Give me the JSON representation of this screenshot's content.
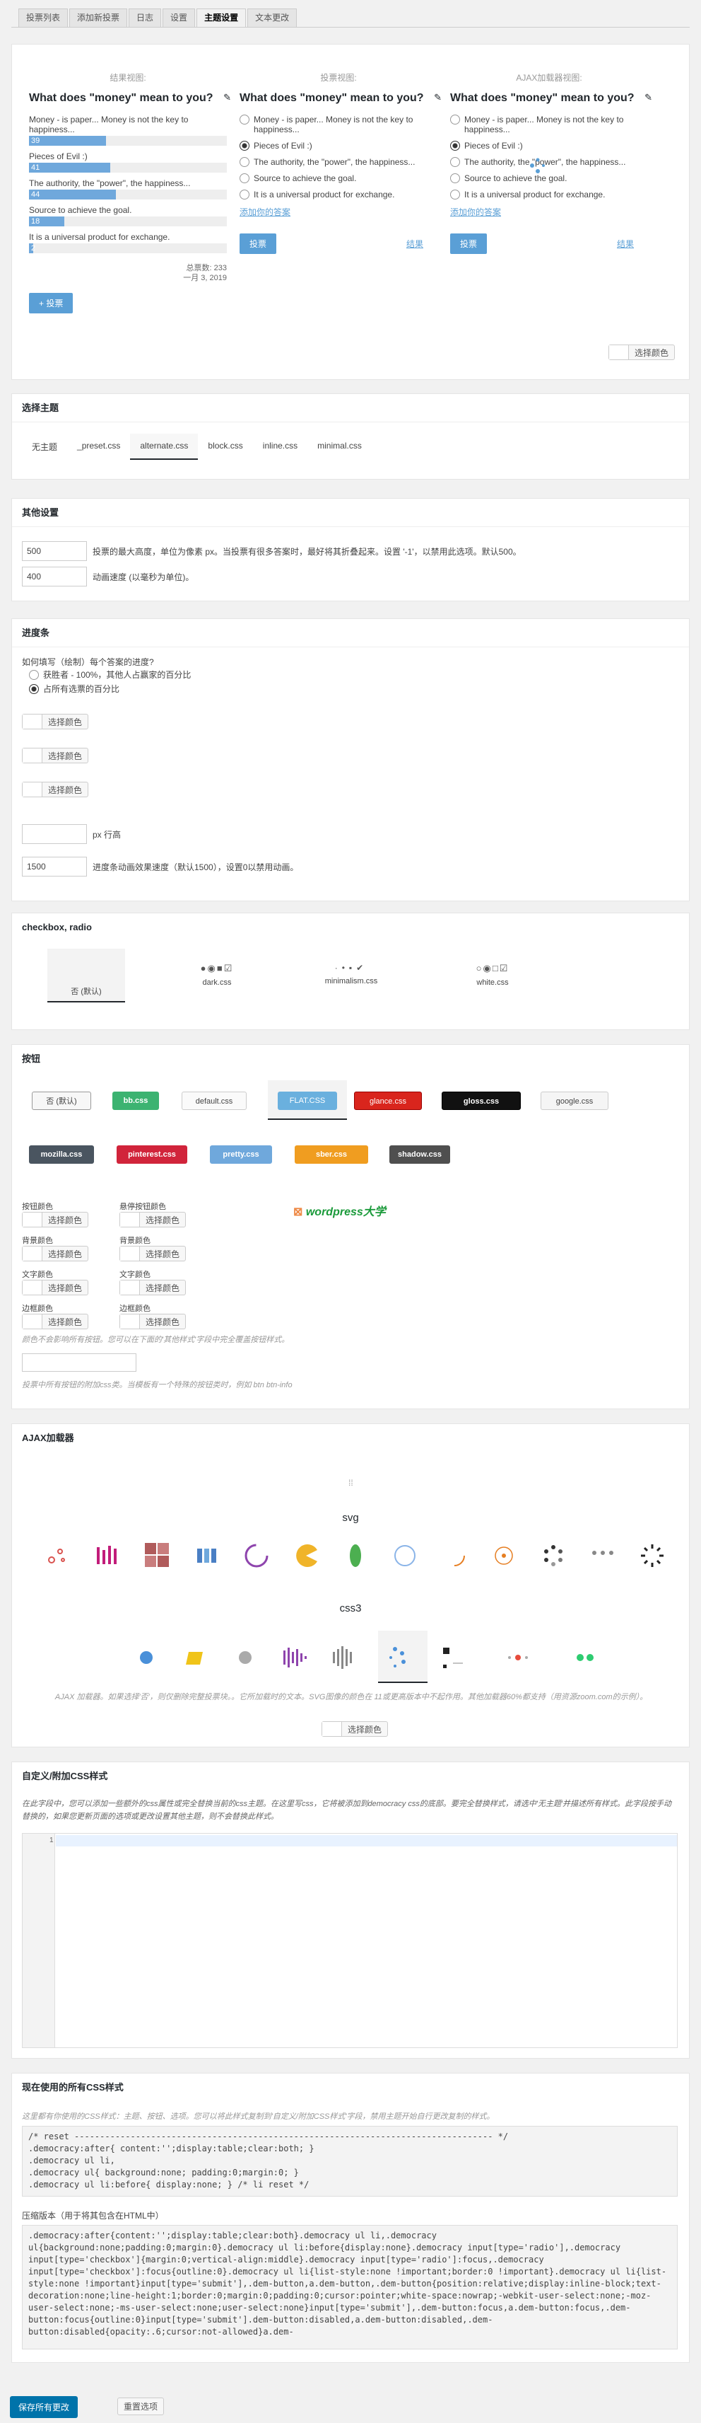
{
  "tabs": [
    "投票列表",
    "添加新投票",
    "日志",
    "设置",
    "主题设置",
    "文本更改"
  ],
  "preview": {
    "headings": [
      "结果视图:",
      "投票视图:",
      "AJAX加载器视图:"
    ],
    "question": "What does \"money\" mean to you?",
    "results": [
      {
        "label": "Money - is paper... Money is not the key to happiness...",
        "pct": "39",
        "fill": 0.39
      },
      {
        "label": "Pieces of Evil :)",
        "pct": "41",
        "fill": 0.41
      },
      {
        "label": "The authority, the \"power\", the happiness...",
        "pct": "44",
        "fill": 0.44
      },
      {
        "label": "Source to achieve the goal.",
        "pct": "18",
        "fill": 0.18
      },
      {
        "label": "It is a universal product for exchange.",
        "pct": "2",
        "fill": 0.02
      }
    ],
    "total": "总票数: 233",
    "date": "一月 3, 2019",
    "add_btn": "+ 投票",
    "vote_btn": "投票",
    "results_link": "结果",
    "add_answer_link": "添加你的答案",
    "choose_color": "选择颜色"
  },
  "theme": {
    "title": "选择主题",
    "tabs": [
      "无主题",
      "_preset.css",
      "alternate.css",
      "block.css",
      "inline.css",
      "minimal.css"
    ]
  },
  "other": {
    "title": "其他设置",
    "height_value": "500",
    "height_desc": "投票的最大高度，单位为像素 px。当投票有很多答案时，最好将其折叠起来。设置 '-1'，以禁用此选项。默认500。",
    "speed_value": "400",
    "speed_desc": "动画速度 (以毫秒为单位)。"
  },
  "progress": {
    "title": "进度条",
    "question": "如何填写（绘制）每个答案的进度?",
    "opt1": "获胜者 - 100%，其他人占赢家的百分比",
    "opt2": "占所有选票的百分比",
    "choose_color": "选择颜色",
    "height_unit": "px 行高",
    "anim_value": "1500",
    "anim_desc": "进度条动画效果速度（默认1500），设置0以禁用动画。"
  },
  "checkbox": {
    "title": "checkbox, radio",
    "items": [
      "否 (默认)",
      "dark.css",
      "minimalism.css",
      "white.css"
    ]
  },
  "buttons": {
    "title": "按钮",
    "row1": [
      "否 (默认)",
      "bb.css",
      "default.css",
      "FLAT.CSS",
      "glance.css",
      "gloss.css",
      "google.css"
    ],
    "row2": [
      "mozilla.css",
      "pinterest.css",
      "pretty.css",
      "sber.css",
      "shadow.css"
    ],
    "labels": [
      "按钮颜色",
      "悬停按钮颜色",
      "背景颜色",
      "背景颜色",
      "文字颜色",
      "文字颜色",
      "边框颜色",
      "边框颜色"
    ],
    "choose_color": "选择颜色",
    "hint1": "颜色不会影响所有按钮。您可以在下面的'其他样式'字段中完全覆盖按钮样式。",
    "hint2": "投票中所有按钮的附加css类。当模板有一个特殊的按钮类时，例如 btn btn-info",
    "logo": "wordpress大学"
  },
  "ajax": {
    "title": "AJAX加载器",
    "svg_label": "svg",
    "css3_label": "css3",
    "hint": "AJAX 加载器。如果选择'否'，则仅删除完整投票块。。它所加载时的文本。SVG图像的颜色在 11或更高版本中不起作用。其他加载器60%都支持（用资源zoom.com的示例）。",
    "choose_color": "选择颜色"
  },
  "custom": {
    "title": "自定义/附加CSS样式",
    "hint": "在此字段中，您可以添加一些额外的css属性或完全替换当前的css主题。在这里写css，它将被添加到democracy css的底部。要完全替换样式，请选中'无主题'并描述所有样式。此字段按手动替换的，如果您更新页面的选项或更改设置其他主题，则不会替换此样式。",
    "line_no": "1"
  },
  "current": {
    "title": "现在使用的所有CSS样式",
    "hint": "这里都有你使用的CSS样式：主题、按钮、选项。您可以将此样式复制到'自定义/附加CSS样式'字段，禁用主题开始自行更改复制的样式。",
    "code": "/* reset ---------------------------------------------------------------------------------- */\n.democracy:after{ content:'';display:table;clear:both; }\n.democracy ul li,\n.democracy ul{ background:none; padding:0;margin:0; }\n.democracy ul li:before{ display:none; } /* li reset */",
    "min_label": "压缩版本（用于将其包含在HTML中）",
    "min_code": ".democracy:after{content:'';display:table;clear:both}.democracy ul li,.democracy ul{background:none;padding:0;margin:0}.democracy ul li:before{display:none}.democracy input[type='radio'],.democracy input[type='checkbox']{margin:0;vertical-align:middle}.democracy input[type='radio']:focus,.democracy input[type='checkbox']:focus{outline:0}.democracy ul li{list-style:none !important;border:0 !important}.democracy ul li{list-style:none !important}input[type='submit'],.dem-button,a.dem-button,.dem-button{position:relative;display:inline-block;text-decoration:none;line-height:1;border:0;margin:0;padding:0;cursor:pointer;white-space:nowrap;-webkit-user-select:none;-moz-user-select:none;-ms-user-select:none;user-select:none}input[type='submit'],.dem-button:focus,a.dem-button:focus,.dem-button:focus{outline:0}input[type='submit'].dem-button:disabled,a.dem-button:disabled,.dem-button:disabled{opacity:.6;cursor:not-allowed}a.dem-"
  },
  "footer": {
    "save": "保存所有更改",
    "reset": "重置选项"
  },
  "colors": {
    "accent": "#5a9fd6",
    "save_bg": "#0073aa"
  }
}
